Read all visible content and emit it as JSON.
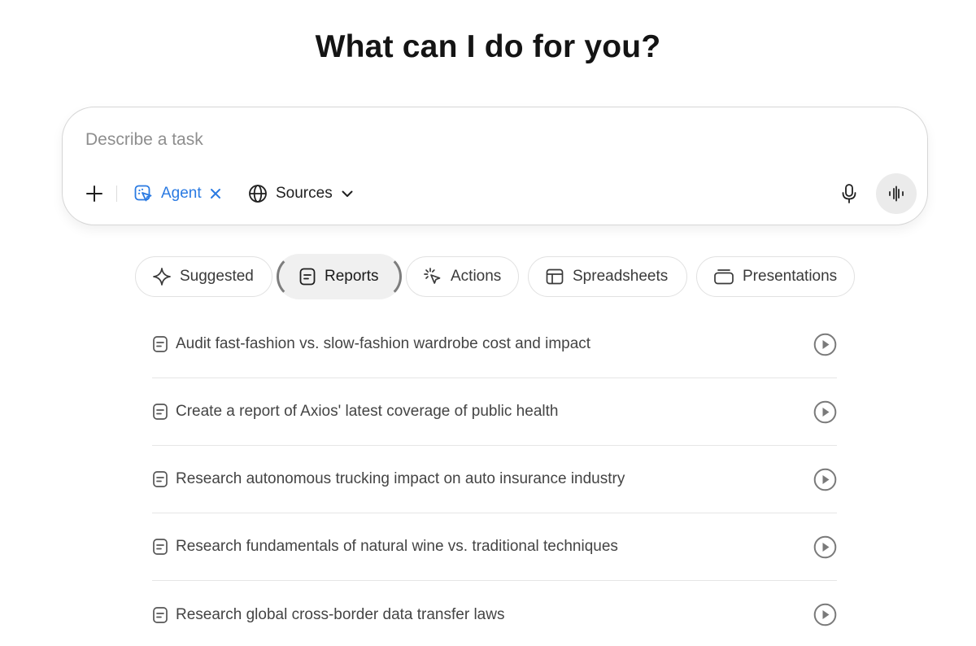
{
  "heading": "What can I do for you?",
  "composer": {
    "placeholder": "Describe a task",
    "agent_label": "Agent",
    "sources_label": "Sources"
  },
  "tabs": [
    {
      "label": "Suggested",
      "icon": "sparkle-icon",
      "active": false
    },
    {
      "label": "Reports",
      "icon": "document-icon",
      "active": true
    },
    {
      "label": "Actions",
      "icon": "cursor-click-icon",
      "active": false
    },
    {
      "label": "Spreadsheets",
      "icon": "table-icon",
      "active": false
    },
    {
      "label": "Presentations",
      "icon": "slides-icon",
      "active": false
    }
  ],
  "tasks": [
    {
      "label": "Audit fast-fashion vs. slow-fashion wardrobe cost and impact"
    },
    {
      "label": "Create a report of Axios' latest coverage of public health"
    },
    {
      "label": "Research autonomous trucking impact on auto insurance industry"
    },
    {
      "label": "Research fundamentals of natural wine vs. traditional techniques"
    },
    {
      "label": "Research global cross-border data transfer laws"
    }
  ],
  "colors": {
    "accent": "#2a7ae2",
    "text": "#1f1f1f",
    "muted": "#8e8e8e",
    "border": "#e1e1e1"
  }
}
